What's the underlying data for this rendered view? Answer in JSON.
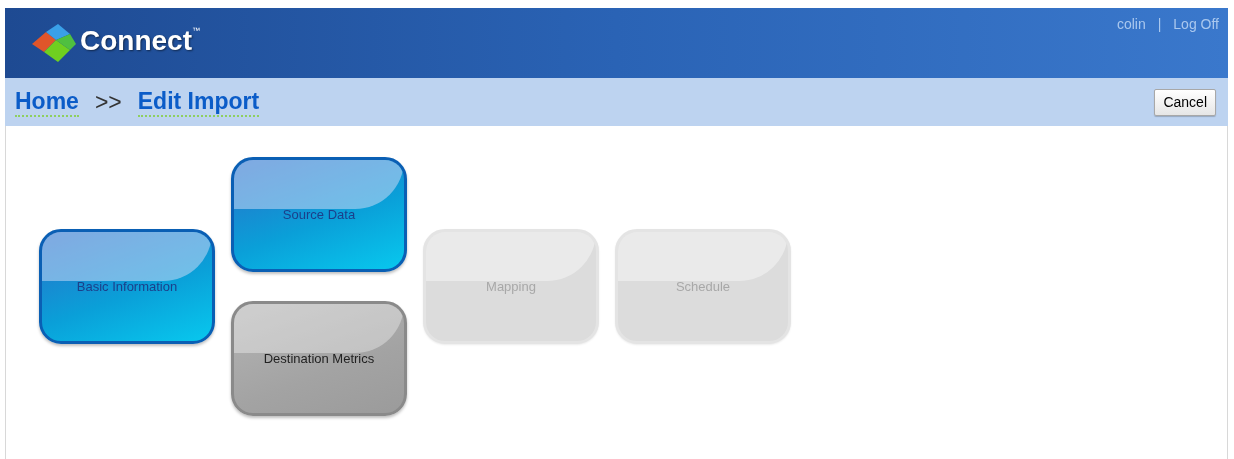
{
  "header": {
    "logo": "Connect",
    "trademark": "™",
    "user": "colin",
    "separator": "|",
    "logout": "Log Off"
  },
  "breadcrumb": {
    "items": [
      "Home",
      "Edit Import"
    ],
    "separator": ">>"
  },
  "cancel": "Cancel",
  "wizard": [
    [
      {
        "label": "Basic Information",
        "kind": "complete"
      }
    ],
    [
      {
        "label": "Source Data",
        "kind": "complete"
      },
      {
        "label": "Destination Metrics",
        "kind": "current"
      }
    ],
    [
      {
        "label": "Mapping",
        "kind": "locked"
      }
    ],
    [
      {
        "label": "Schedule",
        "kind": "locked"
      }
    ]
  ]
}
